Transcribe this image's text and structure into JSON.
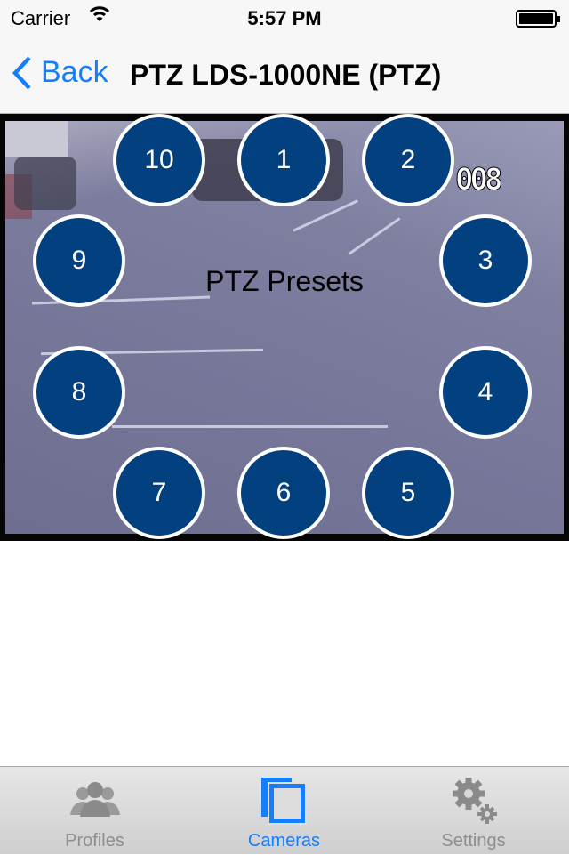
{
  "status_bar": {
    "carrier": "Carrier",
    "time": "5:57 PM",
    "battery_level": 1.0
  },
  "nav": {
    "back_label": "Back",
    "title": "PTZ LDS-1000NE (PTZ)"
  },
  "video": {
    "osd_text": "008",
    "overlay_label": "PTZ Presets"
  },
  "presets": [
    "1",
    "2",
    "3",
    "4",
    "5",
    "6",
    "7",
    "8",
    "9",
    "10"
  ],
  "colors": {
    "accent": "#157efb",
    "preset_fill": "#03407f"
  },
  "tabs": [
    {
      "label": "Profiles",
      "icon": "profiles-icon",
      "active": false
    },
    {
      "label": "Cameras",
      "icon": "cameras-icon",
      "active": true
    },
    {
      "label": "Settings",
      "icon": "gear-icon",
      "active": false
    }
  ]
}
